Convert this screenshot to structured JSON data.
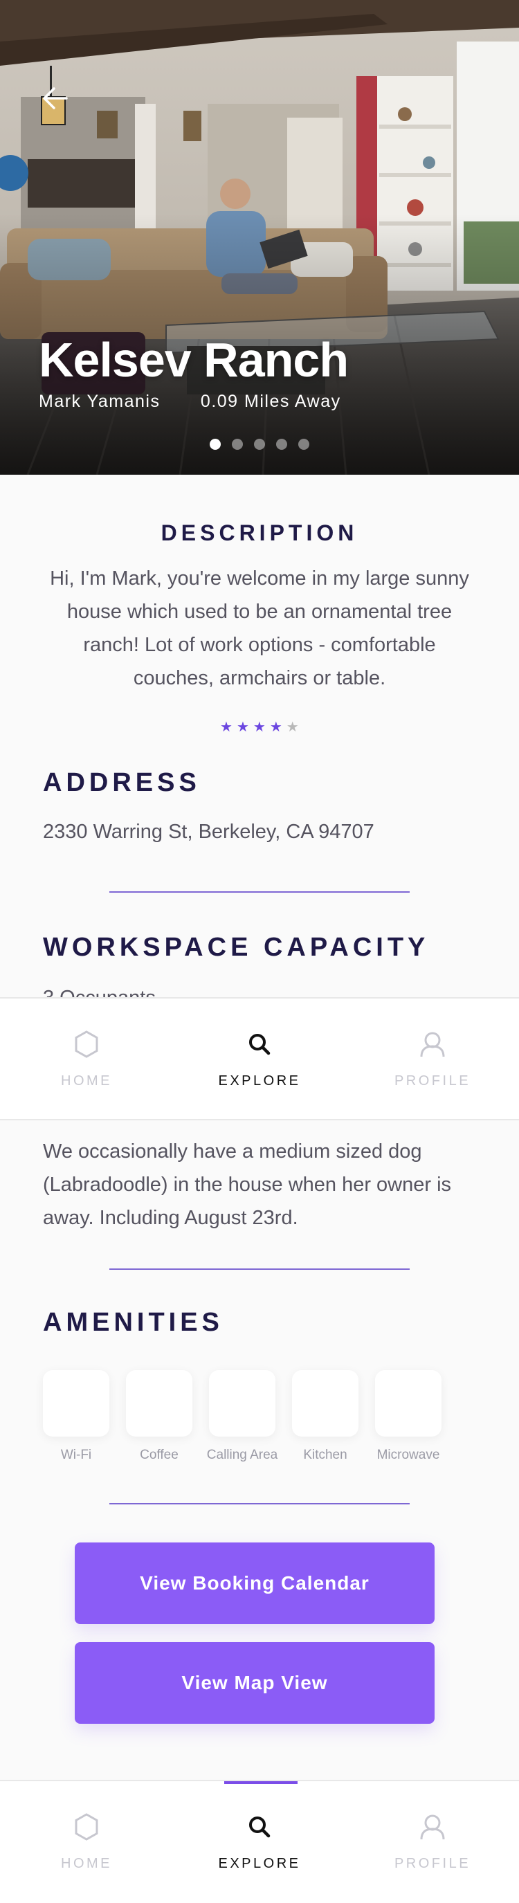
{
  "listing": {
    "title": "Kelsev Ranch",
    "host": "Mark Yamanis",
    "distance": "0.09 Miles Away",
    "photo_count": 5,
    "active_photo": 1
  },
  "description": {
    "heading": "DESCRIPTION",
    "text": "Hi, I'm Mark, you're welcome in my large sunny house which used to be an ornamental tree ranch! Lot of work options - comfortable couches, armchairs or table.",
    "rating": 4,
    "rating_max": 5
  },
  "address": {
    "heading": "ADDRESS",
    "value": "2330 Warring St, Berkeley, CA 94707"
  },
  "capacity": {
    "heading": "WORKSPACE CAPACITY",
    "value": "3 Occupants"
  },
  "notes": {
    "text": "We occasionally have a medium sized dog (Labradoodle) in the house when her owner is away. Including August 23rd."
  },
  "amenities": {
    "heading": "AMENITIES",
    "items": [
      "Wi-Fi",
      "Coffee",
      "Calling Area",
      "Kitchen",
      "Microwave"
    ]
  },
  "buttons": {
    "calendar": "View Booking Calendar",
    "map": "View Map View"
  },
  "nav": {
    "home": "HOME",
    "explore": "EXPLORE",
    "profile": "PROFILE",
    "active": "explore"
  },
  "colors": {
    "accent": "#8b5cf6",
    "heading": "#1f1a47",
    "divider": "#7e67d4"
  }
}
